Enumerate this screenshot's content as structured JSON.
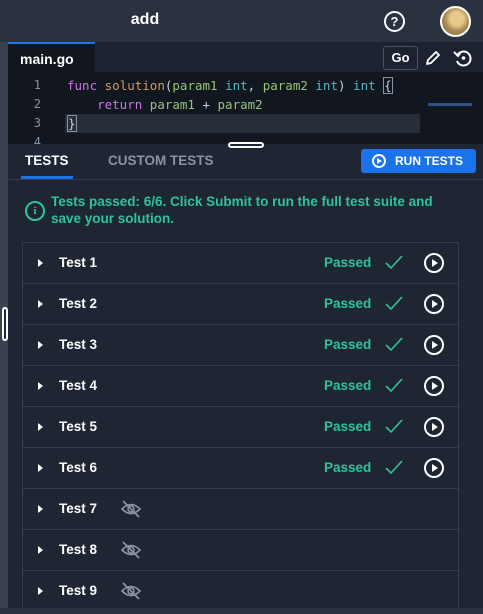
{
  "header": {
    "title": "add"
  },
  "editor": {
    "filename": "main.go",
    "language": "Go",
    "lines": [
      {
        "num": "1",
        "text": "func solution(param1 int, param2 int) int {"
      },
      {
        "num": "2",
        "text": "    return param1 + param2"
      },
      {
        "num": "3",
        "text": "}"
      },
      {
        "num": "4",
        "text": ""
      }
    ]
  },
  "tests_panel": {
    "tabs": [
      "TESTS",
      "CUSTOM TESTS"
    ],
    "run_label": "RUN TESTS",
    "banner": "Tests passed: 6/6. Click Submit to run the full test suite and save your solution.",
    "tests": [
      {
        "name": "Test 1",
        "status": "Passed",
        "hidden": false
      },
      {
        "name": "Test 2",
        "status": "Passed",
        "hidden": false
      },
      {
        "name": "Test 3",
        "status": "Passed",
        "hidden": false
      },
      {
        "name": "Test 4",
        "status": "Passed",
        "hidden": false
      },
      {
        "name": "Test 5",
        "status": "Passed",
        "hidden": false
      },
      {
        "name": "Test 6",
        "status": "Passed",
        "hidden": false
      },
      {
        "name": "Test 7",
        "status": "",
        "hidden": true
      },
      {
        "name": "Test 8",
        "status": "",
        "hidden": true
      },
      {
        "name": "Test 9",
        "status": "",
        "hidden": true
      }
    ]
  },
  "colors": {
    "accent": "#1a73e8",
    "success": "#2fc39a",
    "background": "#1f2633"
  }
}
